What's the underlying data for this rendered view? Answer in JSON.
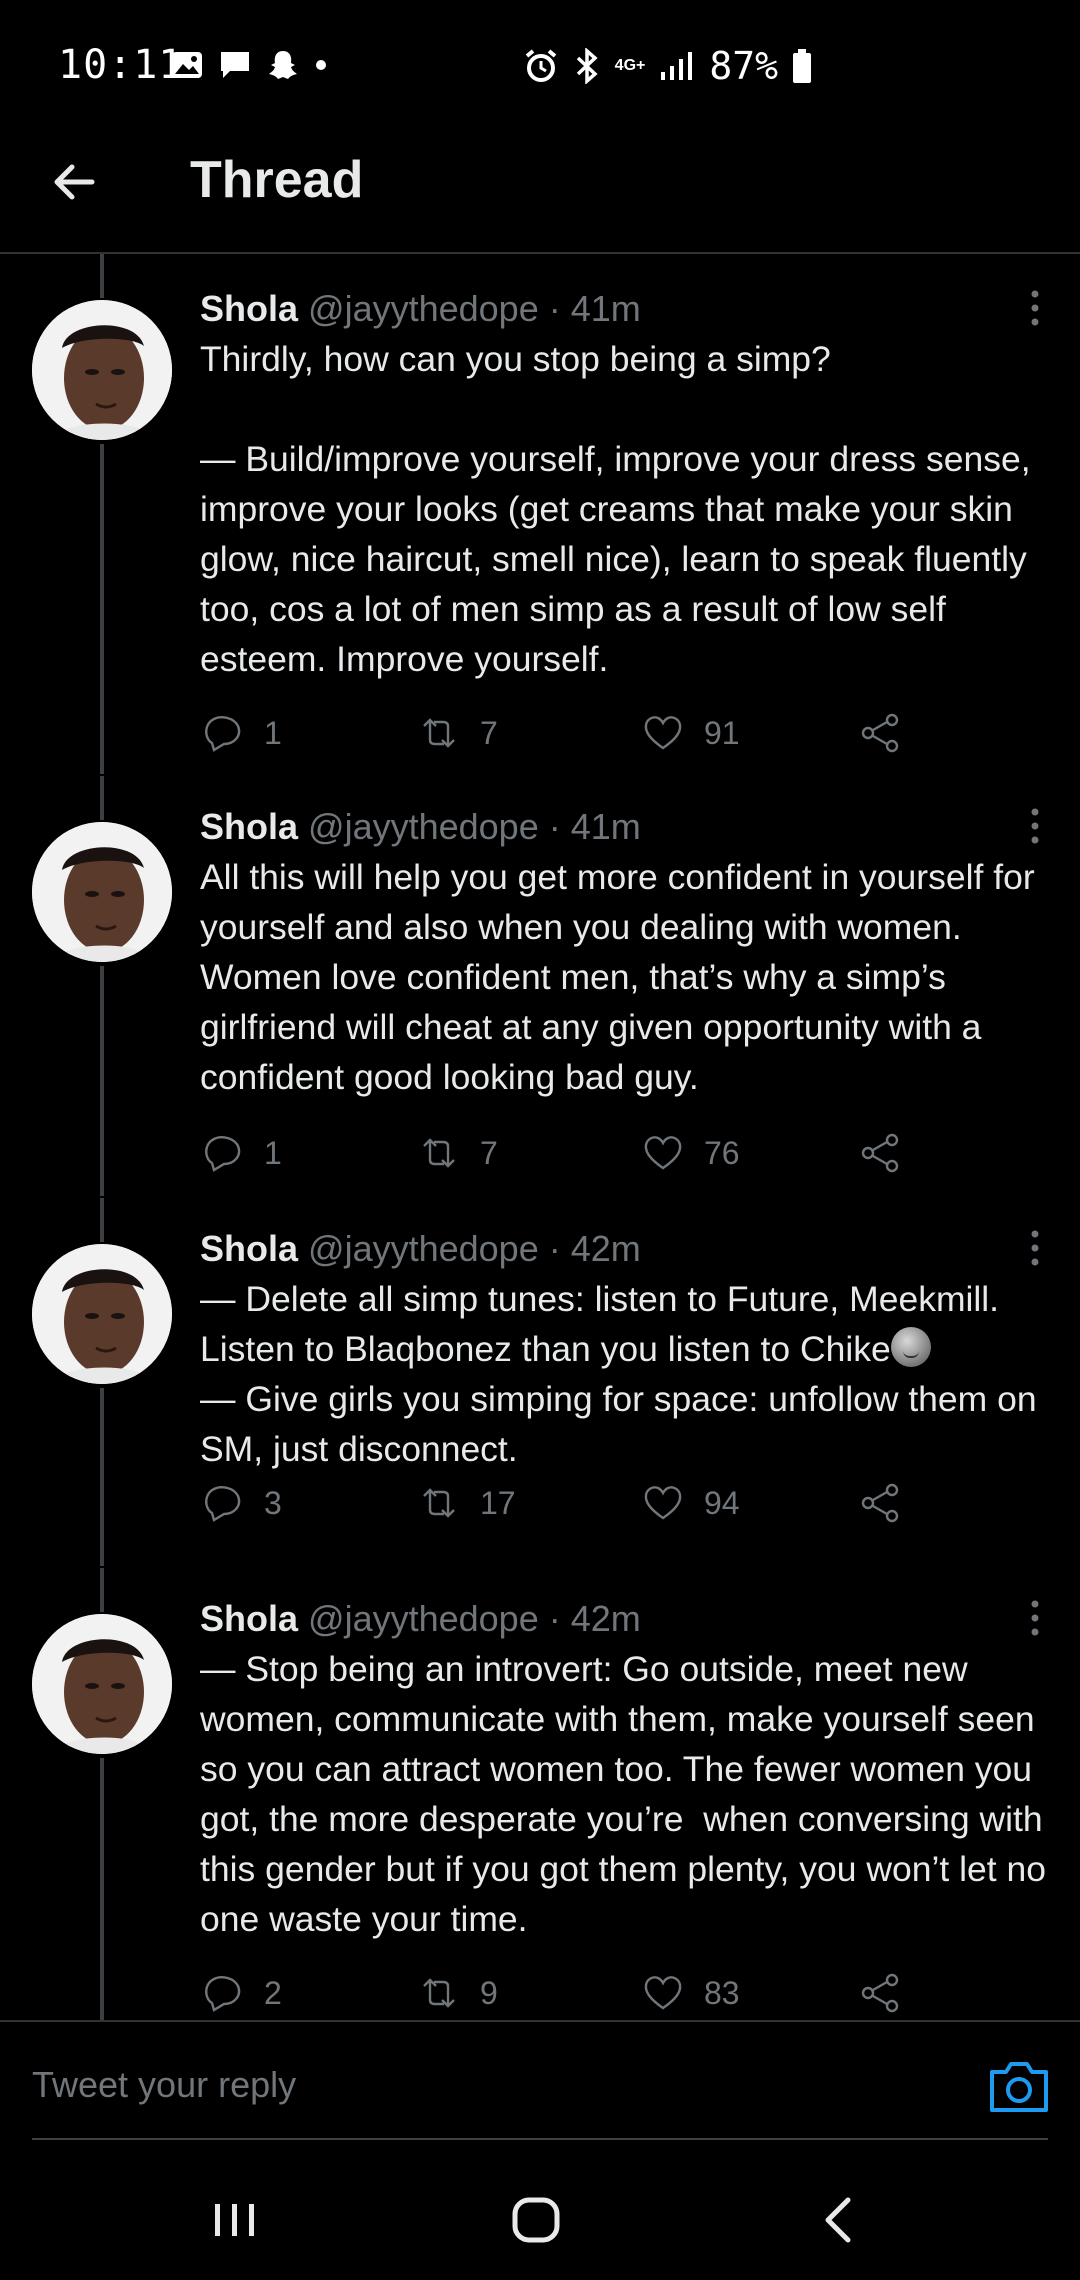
{
  "status_bar": {
    "time": "10:11",
    "network": "4G+",
    "battery": "87%"
  },
  "header": {
    "title": "Thread"
  },
  "tweets": [
    {
      "name": "Shola",
      "handle": "@jayythedope",
      "time": "· 41m",
      "text": "Thirdly, how can you stop being a simp?\n\n— Build/improve yourself, improve your dress sense, improve your looks (get creams that make your skin glow, nice haircut, smell nice), learn to speak fluently too, cos a lot of men simp as a result of low self esteem. Improve yourself.",
      "replies": "1",
      "retweets": "7",
      "likes": "91"
    },
    {
      "name": "Shola",
      "handle": "@jayythedope",
      "time": "· 41m",
      "text": "All this will help you get more confident in yourself for yourself and also when you dealing with women. Women love confident men, that’s why a simp’s girlfriend will cheat at any given opportunity with a confident good looking bad guy.",
      "replies": "1",
      "retweets": "7",
      "likes": "76"
    },
    {
      "name": "Shola",
      "handle": "@jayythedope",
      "time": "· 42m",
      "text_before_emoji": "— Delete all simp tunes: listen to Future, Meekmill. Listen to Blaqbonez than you listen to Chike",
      "text_after_emoji": "\n— Give girls you simping for space: unfollow them on SM, just disconnect.",
      "replies": "3",
      "retweets": "17",
      "likes": "94"
    },
    {
      "name": "Shola",
      "handle": "@jayythedope",
      "time": "· 42m",
      "text": "— Stop being an introvert: Go outside, meet new women, communicate with them, make yourself seen so you can attract women too. The fewer women you got, the more desperate you’re  when conversing with this gender but if you got them plenty, you won’t let no one waste your time.",
      "replies": "2",
      "retweets": "9",
      "likes": "83"
    }
  ],
  "reply": {
    "placeholder": "Tweet your reply"
  },
  "colors": {
    "background": "#000000",
    "text": "#e7e9ea",
    "muted": "#71767b",
    "accent": "#1d9bf0"
  }
}
